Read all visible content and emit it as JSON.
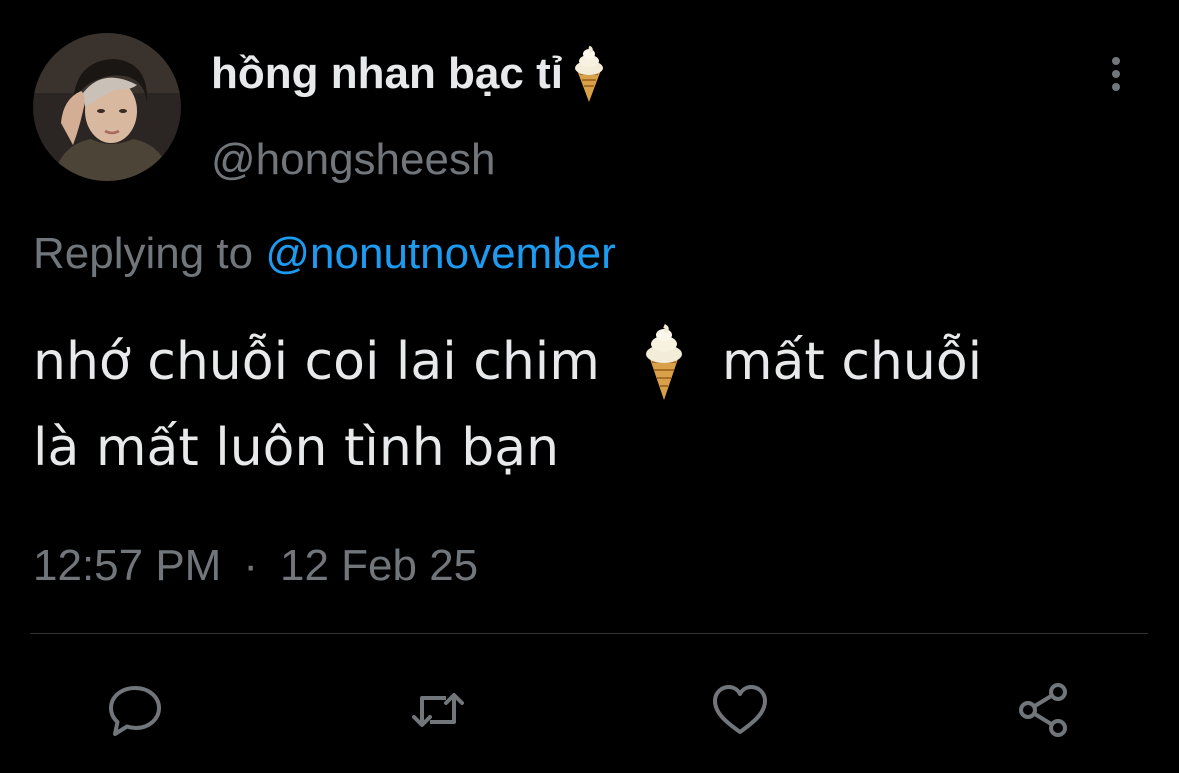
{
  "tweet": {
    "author": {
      "display_name": "hồng nhan bạc tỉ",
      "name_emoji": "soft-ice-cream-icon",
      "handle": "@hongsheesh"
    },
    "reply": {
      "prefix": "Replying to",
      "mention": "@nonutnovember"
    },
    "text": {
      "line1_before": "nhớ chuỗi coi lai chim",
      "line1_after": "mất chuỗi",
      "line2": "là mất luôn tình bạn",
      "inline_emoji": "soft-ice-cream-icon"
    },
    "meta": {
      "time": "12:57 PM",
      "separator": "·",
      "date": "12 Feb 25"
    },
    "actions": [
      "reply-icon",
      "retweet-icon",
      "like-icon",
      "share-icon"
    ]
  },
  "colors": {
    "background": "#000000",
    "text_primary": "#e7e9ea",
    "text_secondary": "#71767b",
    "link": "#1d9bf0",
    "divider": "#2f3336"
  }
}
